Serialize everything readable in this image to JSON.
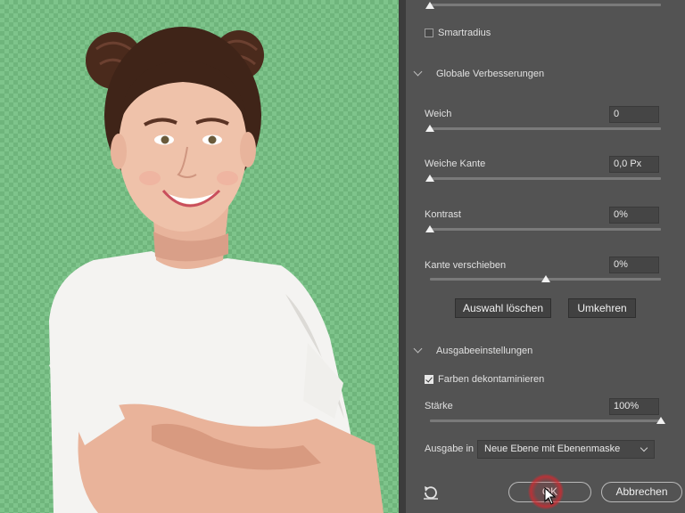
{
  "colors": {
    "panel_bg": "#535353",
    "field_bg": "#454545",
    "canvas_green": "#7ec48b",
    "accent_red": "#d8282f"
  },
  "panel": {
    "smart_radius": {
      "label": "Smartradius",
      "checked": false
    },
    "global_section": {
      "title": "Globale Verbesserungen"
    },
    "sliders": [
      {
        "label": "Weich",
        "value": "0",
        "position": 0.0
      },
      {
        "label": "Weiche Kante",
        "value": "0,0 Px",
        "position": 0.0
      },
      {
        "label": "Kontrast",
        "value": "0%",
        "position": 0.0
      },
      {
        "label": "Kante verschieben",
        "value": "0%",
        "position": 0.5
      }
    ],
    "clear_selection_button": "Auswahl löschen",
    "invert_button": "Umkehren",
    "output_section": {
      "title": "Ausgabeeinstellungen"
    },
    "decontaminate": {
      "label": "Farben dekontaminieren",
      "checked": true
    },
    "strength": {
      "label": "Stärke",
      "value": "100%",
      "position": 1.0
    },
    "output_to": {
      "label": "Ausgabe in",
      "selected": "Neue Ebene mit Ebenenmaske"
    },
    "ok_button": "OK",
    "cancel_button": "Abbrechen",
    "reset_icon": "reset-undo-icon"
  }
}
